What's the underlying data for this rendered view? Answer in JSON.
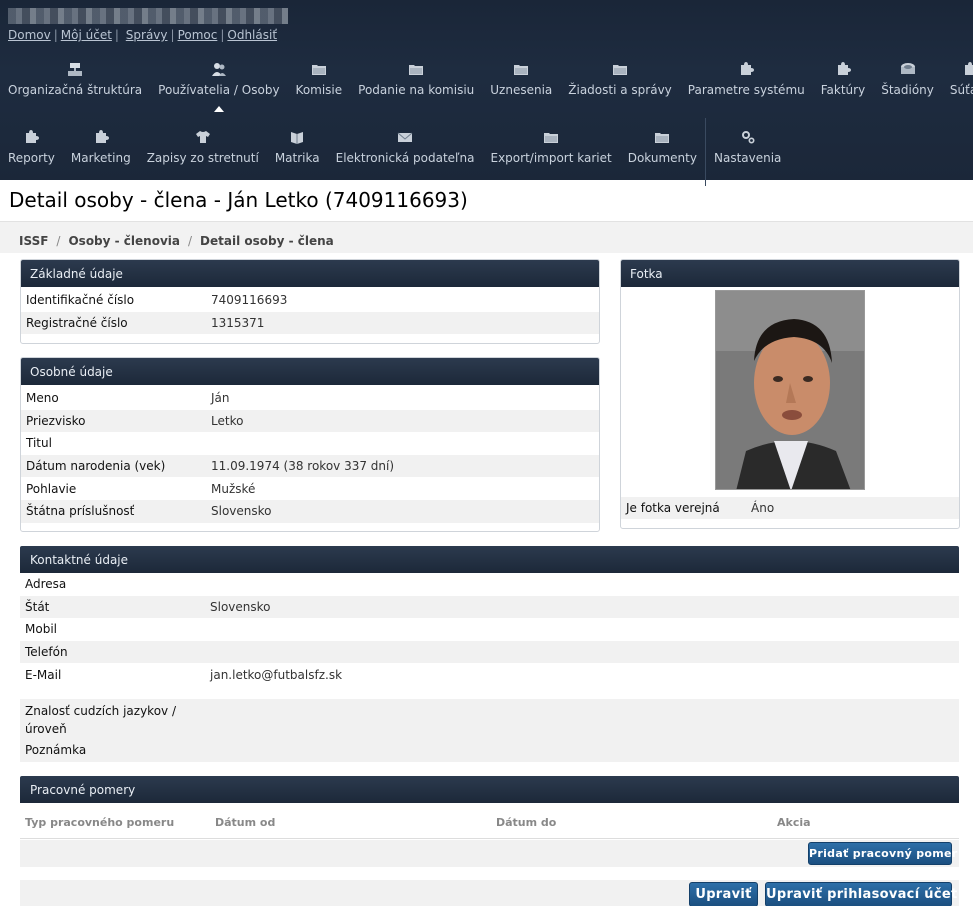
{
  "header": {
    "links": [
      "Domov",
      "Môj účet",
      "Správy",
      "Pomoc",
      "Odhlásiť"
    ]
  },
  "nav": {
    "row1": [
      {
        "label": "Organizačná štruktúra",
        "icon": "tree-icon"
      },
      {
        "label": "Používatelia / Osoby",
        "icon": "users-icon",
        "active": true
      },
      {
        "label": "Komisie",
        "icon": "folder-icon"
      },
      {
        "label": "Podanie na komisiu",
        "icon": "folder-icon"
      },
      {
        "label": "Uznesenia",
        "icon": "folder-icon"
      },
      {
        "label": "Žiadosti a správy",
        "icon": "folder-icon"
      },
      {
        "label": "Parametre systému",
        "icon": "puzzle-icon"
      },
      {
        "label": "Faktúry",
        "icon": "puzzle-icon"
      },
      {
        "label": "Štadióny",
        "icon": "stadium-icon"
      },
      {
        "label": "Súťaže",
        "icon": "puzzle-icon"
      }
    ],
    "row2": [
      {
        "label": "Reporty",
        "icon": "puzzle-icon"
      },
      {
        "label": "Marketing",
        "icon": "puzzle-icon"
      },
      {
        "label": "Zapisy zo stretnutí",
        "icon": "shirt-icon"
      },
      {
        "label": "Matrika",
        "icon": "book-icon"
      },
      {
        "label": "Elektronická podateľna",
        "icon": "envelope-icon"
      },
      {
        "label": "Export/import kariet",
        "icon": "folder-icon"
      },
      {
        "label": "Dokumenty",
        "icon": "folder-icon"
      },
      {
        "label": "Nastavenia",
        "icon": "gears-icon"
      }
    ]
  },
  "page": {
    "title": "Detail osoby - člena - Ján Letko (7409116693)",
    "breadcrumb": [
      "ISSF",
      "Osoby - členovia",
      "Detail osoby - člena"
    ]
  },
  "basic": {
    "heading": "Základné údaje",
    "rows": [
      {
        "k": "Identifikačné číslo",
        "v": "7409116693"
      },
      {
        "k": "Registračné číslo",
        "v": "1315371"
      }
    ]
  },
  "personal": {
    "heading": "Osobné údaje",
    "rows": [
      {
        "k": "Meno",
        "v": "Ján"
      },
      {
        "k": "Priezvisko",
        "v": "Letko"
      },
      {
        "k": "Titul",
        "v": ""
      },
      {
        "k": "Dátum narodenia (vek)",
        "v": "11.09.1974 (38 rokov 337 dní)"
      },
      {
        "k": "Pohlavie",
        "v": "Mužské"
      },
      {
        "k": "Štátna príslušnosť",
        "v": "Slovensko"
      }
    ]
  },
  "photo": {
    "heading": "Fotka",
    "public_label": "Je fotka verejná",
    "public_value": "Áno"
  },
  "contact": {
    "heading": "Kontaktné údaje",
    "rows": [
      {
        "k": "Adresa",
        "v": ""
      },
      {
        "k": "Štát",
        "v": "Slovensko"
      },
      {
        "k": "Mobil",
        "v": ""
      },
      {
        "k": "Telefón",
        "v": ""
      },
      {
        "k": "E-Mail",
        "v": "jan.letko@futbalsfz.sk"
      }
    ],
    "languages_label_1": "Znalosť cudzích jazykov /",
    "languages_label_2": "úroveň",
    "note_label": "Poznámka"
  },
  "work": {
    "heading": "Pracovné pomery",
    "columns": [
      "Typ pracovného pomeru",
      "Dátum od",
      "Dátum do",
      "Akcia"
    ],
    "add_button": "Pridať pracovný pomer"
  },
  "actions": {
    "edit": "Upraviť",
    "edit_account": "Upraviť prihlasovací účet"
  },
  "colors": {
    "header_bg": "#1c2839",
    "button_blue": "#2466a0",
    "row_alt": "#f1f1f1"
  }
}
